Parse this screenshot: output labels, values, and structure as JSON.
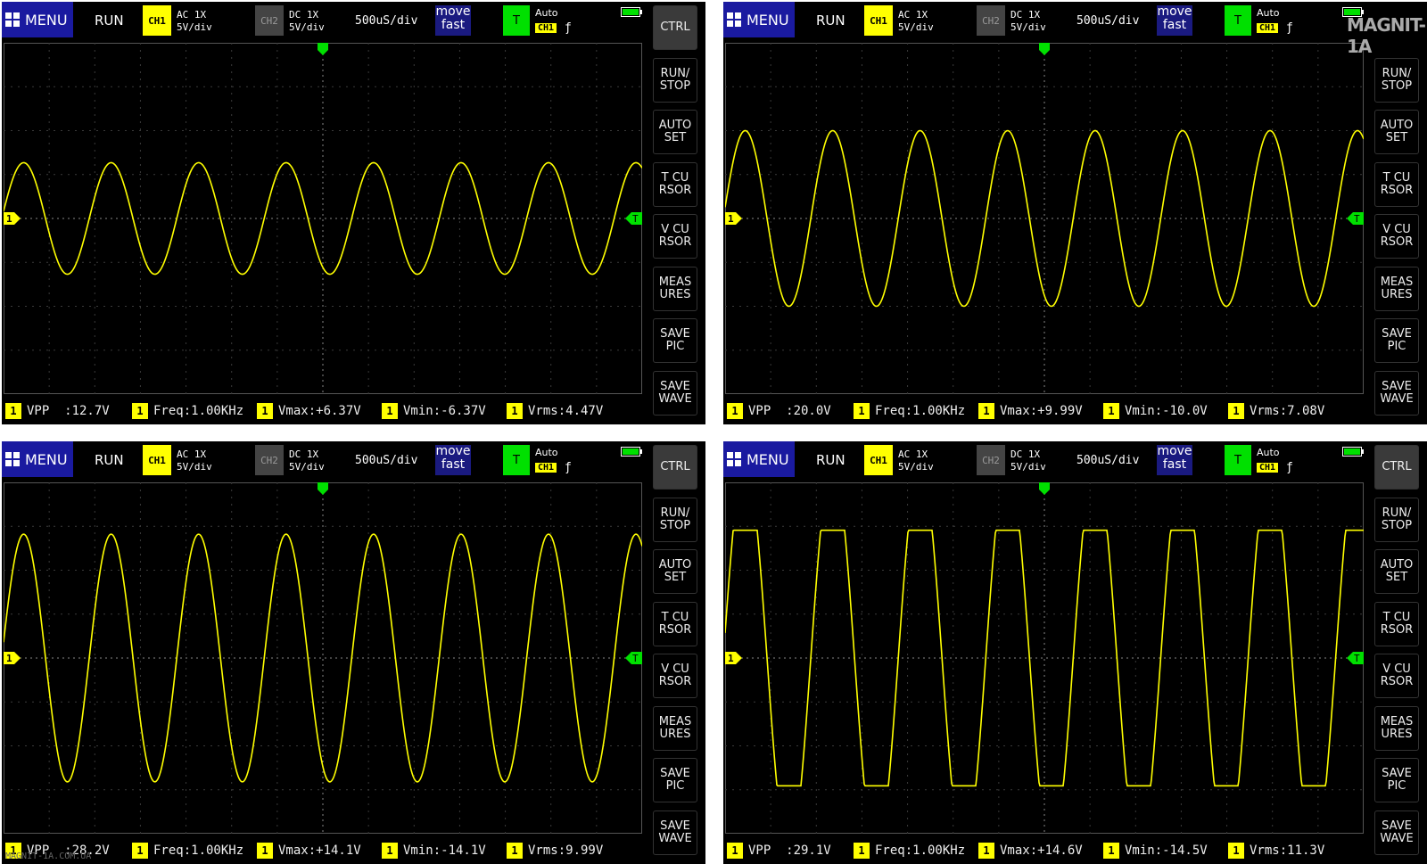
{
  "colors": {
    "trace": "#ffff00",
    "grid": "#3a3a3a",
    "trigger": "#00e000",
    "menu": "#1a1aa0"
  },
  "panels": [
    {
      "header": {
        "menu": "MENU",
        "status": "RUN",
        "ch1": "CH1",
        "ch1_coupling": "AC  1X",
        "ch1_scale": "5V/div",
        "ch2": "CH2",
        "ch2_coupling": "DC  1X",
        "ch2_scale": "5V/div",
        "timebase": "500uS/div",
        "move1": "move",
        "move2": "fast",
        "trig": "T",
        "trig_mode": "Auto",
        "trig_src": "CH1",
        "trig_edge": "ƒ"
      },
      "buttons": [
        "CTRL",
        "RUN/\nSTOP",
        "AUTO\nSET",
        "T CU\nRSOR",
        "V CU\nRSOR",
        "MEAS\nURES",
        "SAVE\nPIC",
        "SAVE\nWAVE"
      ],
      "marker_ch": "1",
      "marker_trig": "T",
      "measures": [
        {
          "idx": "1",
          "text": "VPP  :12.7V"
        },
        {
          "idx": "1",
          "text": "Freq:1.00KHz"
        },
        {
          "idx": "1",
          "text": "Vmax:+6.37V"
        },
        {
          "idx": "1",
          "text": "Vmin:-6.37V"
        },
        {
          "idx": "1",
          "text": "Vrms:4.47V"
        }
      ],
      "wave": {
        "amplitude_div": 1.27,
        "flat_top": 0
      },
      "logo": ""
    },
    {
      "header": {
        "menu": "MENU",
        "status": "RUN",
        "ch1": "CH1",
        "ch1_coupling": "AC  1X",
        "ch1_scale": "5V/div",
        "ch2": "CH2",
        "ch2_coupling": "DC  1X",
        "ch2_scale": "5V/div",
        "timebase": "500uS/div",
        "move1": "move",
        "move2": "fast",
        "trig": "T",
        "trig_mode": "Auto",
        "trig_src": "CH1",
        "trig_edge": "ƒ"
      },
      "buttons": [
        "",
        "RUN/\nSTOP",
        "AUTO\nSET",
        "T CU\nRSOR",
        "V CU\nRSOR",
        "MEAS\nURES",
        "SAVE\nPIC",
        "SAVE\nWAVE"
      ],
      "marker_ch": "1",
      "marker_trig": "T",
      "measures": [
        {
          "idx": "1",
          "text": "VPP  :20.0V"
        },
        {
          "idx": "1",
          "text": "Freq:1.00KHz"
        },
        {
          "idx": "1",
          "text": "Vmax:+9.99V"
        },
        {
          "idx": "1",
          "text": "Vmin:-10.0V"
        },
        {
          "idx": "1",
          "text": "Vrms:7.08V"
        }
      ],
      "wave": {
        "amplitude_div": 2.0,
        "flat_top": 0
      },
      "logo": "MAGNIT-1A"
    },
    {
      "header": {
        "menu": "MENU",
        "status": "RUN",
        "ch1": "CH1",
        "ch1_coupling": "AC  1X",
        "ch1_scale": "5V/div",
        "ch2": "CH2",
        "ch2_coupling": "DC  1X",
        "ch2_scale": "5V/div",
        "timebase": "500uS/div",
        "move1": "move",
        "move2": "fast",
        "trig": "T",
        "trig_mode": "Auto",
        "trig_src": "CH1",
        "trig_edge": "ƒ"
      },
      "buttons": [
        "CTRL",
        "RUN/\nSTOP",
        "AUTO\nSET",
        "T CU\nRSOR",
        "V CU\nRSOR",
        "MEAS\nURES",
        "SAVE\nPIC",
        "SAVE\nWAVE"
      ],
      "marker_ch": "1",
      "marker_trig": "T",
      "measures": [
        {
          "idx": "1",
          "text": "VPP  :28.2V"
        },
        {
          "idx": "1",
          "text": "Freq:1.00KHz"
        },
        {
          "idx": "1",
          "text": "Vmax:+14.1V"
        },
        {
          "idx": "1",
          "text": "Vmin:-14.1V"
        },
        {
          "idx": "1",
          "text": "Vrms:9.99V"
        }
      ],
      "wave": {
        "amplitude_div": 2.82,
        "flat_top": 0
      },
      "logo": ""
    },
    {
      "header": {
        "menu": "MENU",
        "status": "RUN",
        "ch1": "CH1",
        "ch1_coupling": "AC  1X",
        "ch1_scale": "5V/div",
        "ch2": "CH2",
        "ch2_coupling": "DC  1X",
        "ch2_scale": "5V/div",
        "timebase": "500uS/div",
        "move1": "move",
        "move2": "fast",
        "trig": "T",
        "trig_mode": "Auto",
        "trig_src": "CH1",
        "trig_edge": "ƒ"
      },
      "buttons": [
        "CTRL",
        "RUN/\nSTOP",
        "AUTO\nSET",
        "T CU\nRSOR",
        "V CU\nRSOR",
        "MEAS\nURES",
        "SAVE\nPIC",
        "SAVE\nWAVE"
      ],
      "marker_ch": "1",
      "marker_trig": "T",
      "measures": [
        {
          "idx": "1",
          "text": "VPP  :29.1V"
        },
        {
          "idx": "1",
          "text": "Freq:1.00KHz"
        },
        {
          "idx": "1",
          "text": "Vmax:+14.6V"
        },
        {
          "idx": "1",
          "text": "Vmin:-14.5V"
        },
        {
          "idx": "1",
          "text": "Vrms:11.3V"
        }
      ],
      "wave": {
        "amplitude_div": 2.91,
        "flat_top": 0.35
      },
      "logo": ""
    }
  ],
  "watermark": "MAGNIT-1A.COM.UA"
}
